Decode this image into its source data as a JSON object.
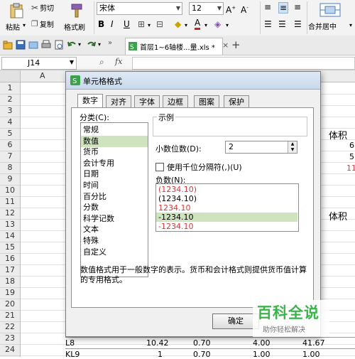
{
  "ribbon": {
    "cut_label": "剪切",
    "paste_label": "粘贴",
    "copy_label": "复制",
    "format_painter_label": "格式刷",
    "font_name": "宋体",
    "font_size": "12",
    "bold": "B",
    "italic": "I",
    "underline": "U",
    "font_color_label": "A",
    "merge_center_label": "合并居中"
  },
  "toolbar": {
    "file_tab": "首层1~6轴楼...量.xls *",
    "add_tab": "+"
  },
  "formula_bar": {
    "cell_ref": "J14",
    "fx": "fx"
  },
  "grid": {
    "col_a": "A",
    "rows": [
      "1",
      "2",
      "3",
      "4",
      "5",
      "6",
      "7",
      "8",
      "9",
      "10",
      "11",
      "12",
      "13",
      "14",
      "15",
      "16",
      "17",
      "18",
      "19",
      "20",
      "21",
      "22",
      "23",
      "24"
    ],
    "right_labels": {
      "r5": "体积",
      "r12": "体积"
    },
    "right_vals": {
      "r6": "6",
      "r7": "5",
      "r8": "11"
    },
    "bottom_rows": [
      {
        "id": "L8",
        "c1": "10.42",
        "c2": "0.70",
        "c3": "4.00",
        "c4": "41.67"
      },
      {
        "id": "KL9",
        "c1": "1",
        "c2": "0.70",
        "c3": "1.00",
        "c4": "1.00"
      }
    ]
  },
  "dialog": {
    "title": "单元格格式",
    "tabs": [
      "数字",
      "对齐",
      "字体",
      "边框",
      "图案",
      "保护"
    ],
    "category_label": "分类(C):",
    "categories": [
      "常规",
      "数值",
      "货币",
      "会计专用",
      "日期",
      "时间",
      "百分比",
      "分数",
      "科学记数",
      "文本",
      "特殊",
      "自定义"
    ],
    "sample_label": "示例",
    "decimal_label": "小数位数(D):",
    "decimal_value": "2",
    "thousands_label": "使用千位分隔符(,)(U)",
    "negative_label": "负数(N):",
    "negatives": [
      "(1234.10)",
      "(1234.10)",
      "1234.10",
      "-1234.10",
      "-1234.10"
    ],
    "description": "数值格式用于一般数字的表示。货币和会计格式则提供货币值计算的专用格式。",
    "ok_label": "确定"
  },
  "watermark": {
    "title": "百科全说",
    "subtitle": "助你轻松解决"
  },
  "colors": {
    "accent": "#3aa24a",
    "selection": "#cfe3bf",
    "negative_red": "#d23b3b",
    "watermark_green": "#39b54a"
  }
}
